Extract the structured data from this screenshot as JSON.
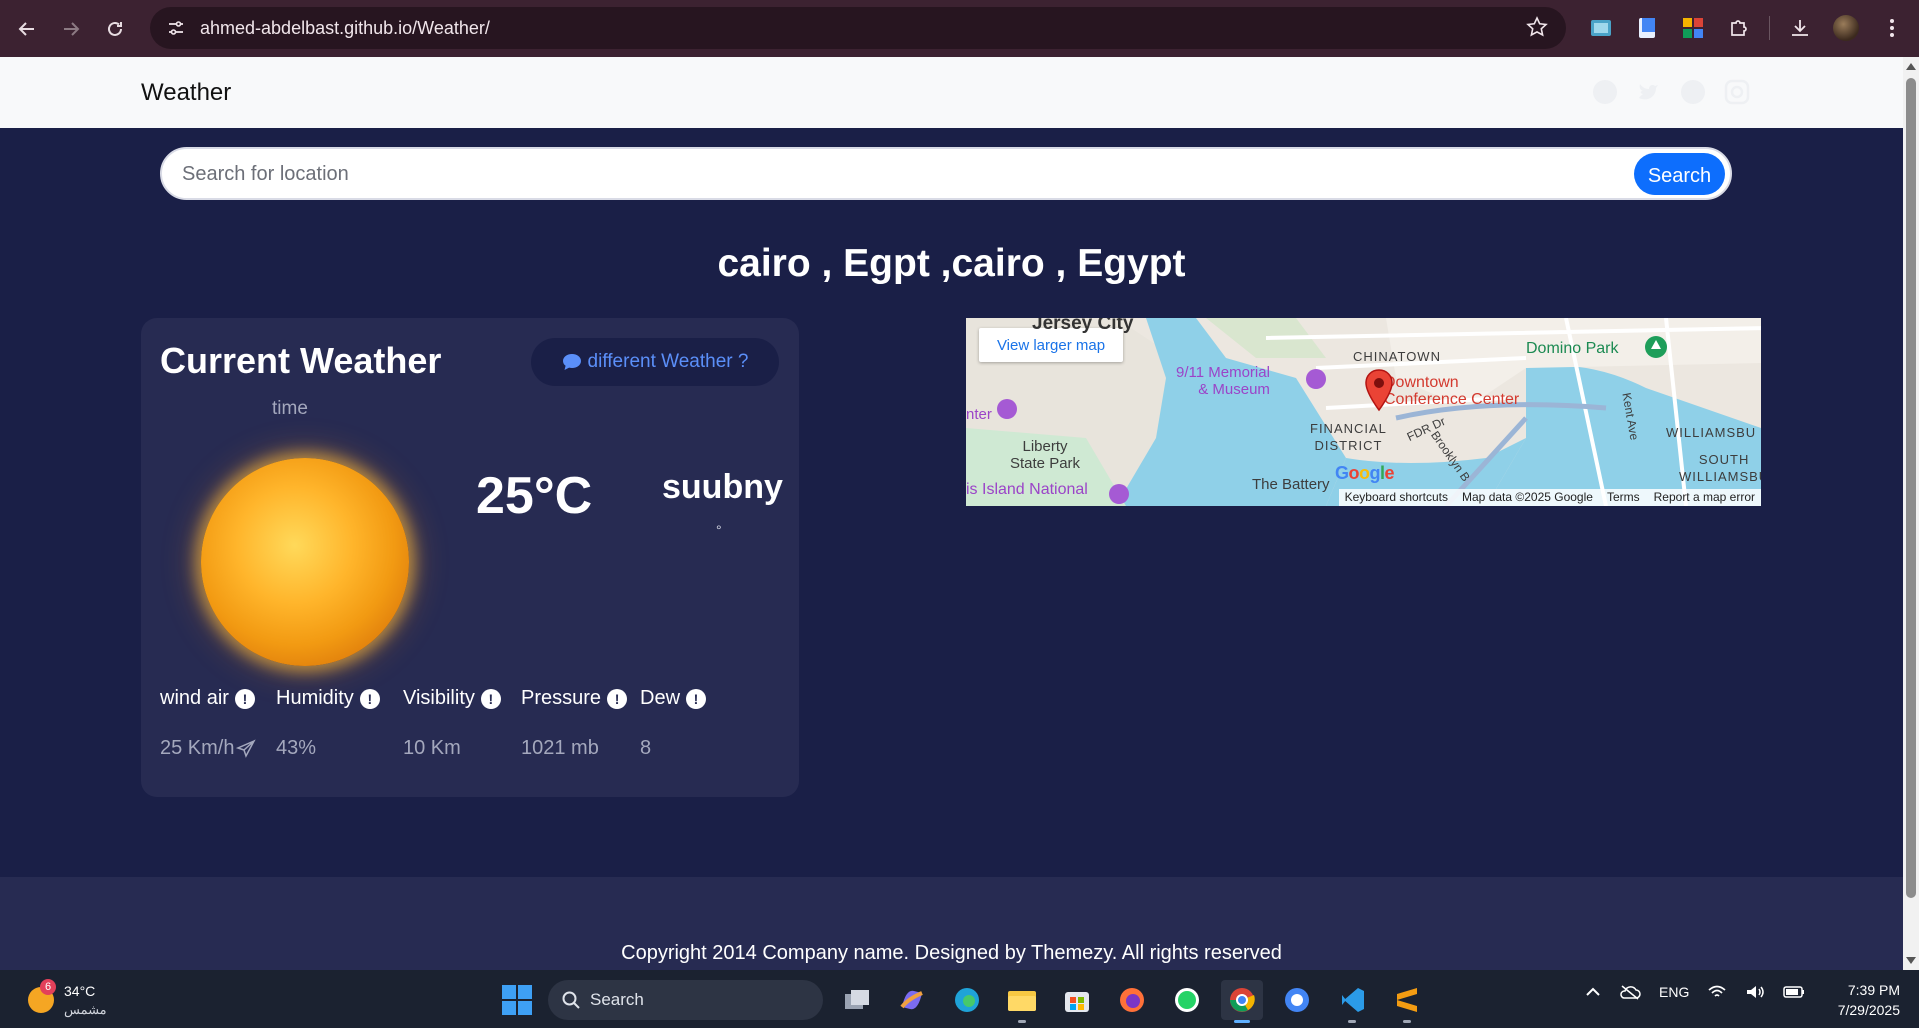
{
  "browser": {
    "url": "ahmed-abdelbast.github.io/Weather/"
  },
  "navbar": {
    "brand": "Weather",
    "socials": [
      "facebook-icon",
      "twitter-icon",
      "github-icon",
      "instagram-icon"
    ]
  },
  "search": {
    "placeholder": "Search for location",
    "button_label": "Search"
  },
  "location_title": "cairo , Egpt ,cairo , Egypt",
  "current_weather": {
    "title": "Current Weather",
    "different_button": "different Weather ?",
    "time_label": "time",
    "temperature": "25°C",
    "condition": "suubny",
    "degree_marker": "°",
    "stats": [
      {
        "label": "wind air",
        "value": "25 Km/h"
      },
      {
        "label": "Humidity",
        "value": "43%"
      },
      {
        "label": "Visibility",
        "value": "10 Km"
      },
      {
        "label": "Pressure",
        "value": "1021 mb"
      },
      {
        "label": "Dew",
        "value": "8"
      }
    ]
  },
  "map": {
    "larger_map_link": "View larger map",
    "labels": {
      "jersey_city": "Jersey City",
      "memorial": "9/11 Memorial\n& Museum",
      "chinatown": "CHINATOWN",
      "domino_park": "Domino Park",
      "downtown": "Downtown\nConference Center",
      "financial": "FINANCIAL\nDISTRICT",
      "fdr": "FDR Dr",
      "brooklyn": "Brooklyn B",
      "kent": "Kent Ave",
      "williamsburg": "WILLIAMSBU",
      "south_williamsburg": "SOUTH\nWILLIAMSBU",
      "liberty": "Liberty\nState Park",
      "battery": "The Battery",
      "ellis": "is Island National",
      "center": "nter"
    },
    "google_logo": "Google",
    "footer": [
      "Keyboard shortcuts",
      "Map data ©2025 Google",
      "Terms",
      "Report a map error"
    ]
  },
  "footer": {
    "copyright": "Copyright 2014 Company name. Designed by Themezy. All rights reserved"
  },
  "taskbar": {
    "weather_temp": "34°C",
    "weather_condition": "مشمس",
    "weather_badge": "6",
    "search_label": "Search",
    "language": "ENG",
    "time": "7:39 PM",
    "date": "7/29/2025"
  },
  "colors": {
    "page_bg": "#1a1f47",
    "card_bg": "#272b52",
    "accent": "#0d6efd",
    "link_accent": "#5b8ff9"
  }
}
